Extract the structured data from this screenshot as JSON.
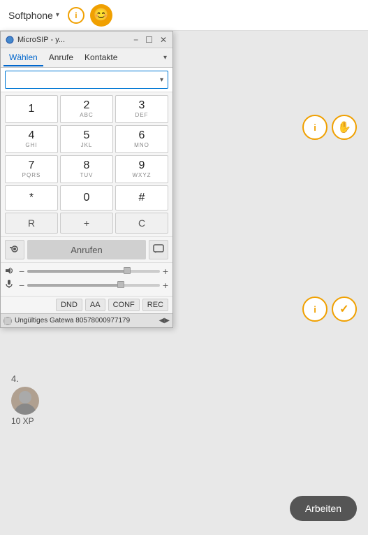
{
  "topbar": {
    "title": "Softphone",
    "dropdown_arrow": "▾",
    "info_icon": "i",
    "smiley": "😊"
  },
  "microsip": {
    "window_title": "MicroSIP - y...",
    "controls": {
      "minimize": "−",
      "maximize": "☐",
      "close": "✕"
    },
    "tabs": [
      {
        "label": "Wählen",
        "active": true
      },
      {
        "label": "Anrufe",
        "active": false
      },
      {
        "label": "Kontakte",
        "active": false
      }
    ],
    "tab_dropdown": "▾",
    "dial_input_placeholder": "",
    "dial_chevron": "▾",
    "keypad": [
      {
        "main": "1",
        "sub": ""
      },
      {
        "main": "2",
        "sub": "ABC"
      },
      {
        "main": "3",
        "sub": "DEF"
      },
      {
        "main": "4",
        "sub": "GHI"
      },
      {
        "main": "5",
        "sub": "JKL"
      },
      {
        "main": "6",
        "sub": "MNO"
      },
      {
        "main": "7",
        "sub": "PQRS"
      },
      {
        "main": "8",
        "sub": "TUV"
      },
      {
        "main": "9",
        "sub": "WXYZ"
      },
      {
        "main": "*",
        "sub": ""
      },
      {
        "main": "0",
        "sub": ""
      },
      {
        "main": "#",
        "sub": ""
      }
    ],
    "special_keys": [
      {
        "label": "R"
      },
      {
        "label": "+"
      },
      {
        "label": "C"
      }
    ],
    "call_button": "Anrufen",
    "camera_icon": "📷",
    "msg_icon": "💬",
    "volume_speaker_icon": "🔊",
    "volume_mic_icon": "🎤",
    "bottom_buttons": [
      {
        "label": "DND"
      },
      {
        "label": "AA"
      },
      {
        "label": "CONF"
      },
      {
        "label": "REC"
      }
    ],
    "status_text": "Ungültiges Gatewa 80578000977179",
    "status_arrows": "◀▶"
  },
  "right_icons_top": {
    "info_icon": "i",
    "hand_icon": "✋"
  },
  "right_icons_bottom": {
    "info_icon": "i",
    "check_icon": "✓"
  },
  "user": {
    "number": "4.",
    "avatar_emoji": "👤",
    "xp_label": "10 XP"
  },
  "arbeiten_btn": "Arbeiten"
}
